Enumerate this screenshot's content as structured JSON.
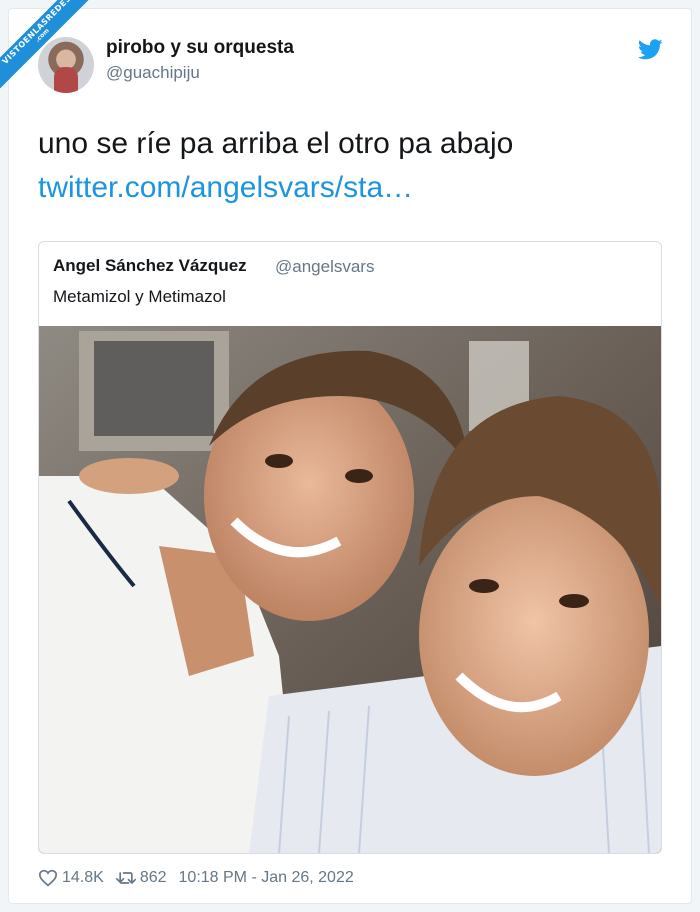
{
  "watermark": {
    "main": "VISTOENLASREDES",
    "sub": ".com"
  },
  "tweet": {
    "display_name": "pirobo y su orquesta",
    "handle": "@guachipiju",
    "text": "uno se ríe pa arriba el otro pa abajo",
    "link": "twitter.com/angelsvars/sta…"
  },
  "quoted_tweet": {
    "display_name": "Angel Sánchez Vázquez",
    "handle": "@angelsvars",
    "text": "Metamizol y Metimazol"
  },
  "footer": {
    "likes": "14.8K",
    "retweets": "862",
    "timestamp": "10:18 PM - Jan 26, 2022"
  },
  "icons": {
    "brand": "twitter-bird-icon",
    "like": "heart-icon",
    "retweet": "retweet-icon"
  },
  "colors": {
    "link": "#1b95e0",
    "brand": "#1da1f2",
    "secondary_text": "#657786",
    "watermark": "#1e8fd8"
  }
}
